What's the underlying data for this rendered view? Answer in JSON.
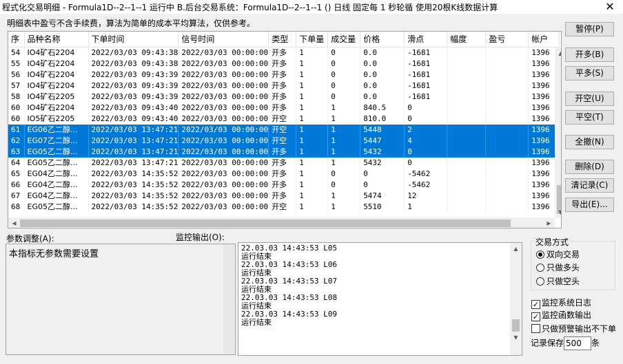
{
  "window": {
    "title": "程式化交易明细 - Formula1D--2--1--1 运行中  B.后台交易系统：Formula1D--2--1--1 () 日线 固定每 1 秒轮循 使用20根K线数据计算",
    "close": "✕"
  },
  "hint": "明细表中盈亏不含手续费，算法为简单的成本平均算法，仅供参考。",
  "table": {
    "columns": [
      "序",
      "品种名称",
      "下单时间",
      "信号时间",
      "类型",
      "下单量",
      "成交量",
      "价格",
      "滑点",
      "幅度",
      "盈亏",
      "帐户"
    ],
    "rows": [
      {
        "seq": "54",
        "name": "IO4矿石2204",
        "order_time": "2022/03/03 09:43:38",
        "signal_time": "2022/03/03 00:00:00",
        "type": "开多",
        "qty": "1",
        "filled": "0",
        "price": "0.0",
        "slip": "-1681",
        "range": "",
        "pnl": "",
        "acct": "1396",
        "selected": false
      },
      {
        "seq": "55",
        "name": "IO4矿石2204",
        "order_time": "2022/03/03 09:43:38",
        "signal_time": "2022/03/03 00:00:00",
        "type": "开多",
        "qty": "1",
        "filled": "0",
        "price": "0.0",
        "slip": "-1681",
        "range": "",
        "pnl": "",
        "acct": "1396",
        "selected": false
      },
      {
        "seq": "56",
        "name": "IO4矿石2204",
        "order_time": "2022/03/03 09:43:39",
        "signal_time": "2022/03/03 00:00:00",
        "type": "开多",
        "qty": "1",
        "filled": "0",
        "price": "0.0",
        "slip": "-1681",
        "range": "",
        "pnl": "",
        "acct": "1396",
        "selected": false
      },
      {
        "seq": "57",
        "name": "IO4矿石2204",
        "order_time": "2022/03/03 09:43:39",
        "signal_time": "2022/03/03 00:00:00",
        "type": "开多",
        "qty": "1",
        "filled": "0",
        "price": "0.0",
        "slip": "-1681",
        "range": "",
        "pnl": "",
        "acct": "1396",
        "selected": false
      },
      {
        "seq": "58",
        "name": "IO4矿石2205",
        "order_time": "2022/03/03 09:43:39",
        "signal_time": "2022/03/03 00:00:00",
        "type": "开多",
        "qty": "1",
        "filled": "0",
        "price": "0.0",
        "slip": "-1681",
        "range": "",
        "pnl": "",
        "acct": "1396",
        "selected": false
      },
      {
        "seq": "60",
        "name": "IO4矿石2204",
        "order_time": "2022/03/03 09:43:40",
        "signal_time": "2022/03/03 00:00:00",
        "type": "开多",
        "qty": "1",
        "filled": "1",
        "price": "840.5",
        "slip": "0",
        "range": "",
        "pnl": "",
        "acct": "1396",
        "selected": false
      },
      {
        "seq": "60",
        "name": "IO5矿石2205",
        "order_time": "2022/03/03 09:43:40",
        "signal_time": "2022/03/03 00:00:00",
        "type": "开空",
        "qty": "1",
        "filled": "1",
        "price": "810.0",
        "slip": "0",
        "range": "",
        "pnl": "",
        "acct": "1396",
        "selected": false
      },
      {
        "seq": "61",
        "name": "EG06乙二醇...",
        "order_time": "2022/03/03 13:47:21",
        "signal_time": "2022/03/03 00:00:00",
        "type": "开空",
        "qty": "1",
        "filled": "1",
        "price": "5448",
        "slip": "2",
        "range": "",
        "pnl": "",
        "acct": "1396",
        "selected": true
      },
      {
        "seq": "62",
        "name": "EG07乙二醇...",
        "order_time": "2022/03/03 13:47:21",
        "signal_time": "2022/03/03 00:00:00",
        "type": "开空",
        "qty": "1",
        "filled": "1",
        "price": "5447",
        "slip": "4",
        "range": "",
        "pnl": "",
        "acct": "1396",
        "selected": true
      },
      {
        "seq": "63",
        "name": "EG05乙二醇...",
        "order_time": "2022/03/03 13:47:21",
        "signal_time": "2022/03/03 00:00:00",
        "type": "开多",
        "qty": "1",
        "filled": "1",
        "price": "5432",
        "slip": "0",
        "range": "",
        "pnl": "",
        "acct": "1396",
        "selected": true
      },
      {
        "seq": "64",
        "name": "EG05乙二醇...",
        "order_time": "2022/03/03 13:47:21",
        "signal_time": "2022/03/03 00:00:00",
        "type": "开多",
        "qty": "1",
        "filled": "1",
        "price": "5432",
        "slip": "0",
        "range": "",
        "pnl": "",
        "acct": "1396",
        "selected": false
      },
      {
        "seq": "65",
        "name": "EG04乙二醇...",
        "order_time": "2022/03/03 14:35:52",
        "signal_time": "2022/03/03 00:00:00",
        "type": "开多",
        "qty": "1",
        "filled": "0",
        "price": "0",
        "slip": "-5462",
        "range": "",
        "pnl": "",
        "acct": "1396",
        "selected": false
      },
      {
        "seq": "66",
        "name": "EG04乙二醇...",
        "order_time": "2022/03/03 14:35:52",
        "signal_time": "2022/03/03 00:00:00",
        "type": "开多",
        "qty": "1",
        "filled": "0",
        "price": "0",
        "slip": "-5462",
        "range": "",
        "pnl": "",
        "acct": "1396",
        "selected": false
      },
      {
        "seq": "67",
        "name": "EG04乙二醇...",
        "order_time": "2022/03/03 14:35:52",
        "signal_time": "2022/03/03 00:00:00",
        "type": "开多",
        "qty": "1",
        "filled": "1",
        "price": "5474",
        "slip": "12",
        "range": "",
        "pnl": "",
        "acct": "1396",
        "selected": false
      },
      {
        "seq": "68",
        "name": "EG05乙二醇...",
        "order_time": "2022/03/03 14:35:52",
        "signal_time": "2022/03/03 00:00:00",
        "type": "开空",
        "qty": "1",
        "filled": "1",
        "price": "5510",
        "slip": "1",
        "range": "",
        "pnl": "",
        "acct": "1396",
        "selected": false
      }
    ]
  },
  "buttons": {
    "pause": "暂停(P)",
    "open_long": "开多(B)",
    "close_long": "平多(S)",
    "open_short": "开空(U)",
    "close_short": "平空(T)",
    "cancel_all": "全撤(N)",
    "delete": "删除(D)",
    "clear": "清记录(C)",
    "export": "导出(E)..."
  },
  "params": {
    "label": "参数调整(A):",
    "text": "本指标无参数需要设置"
  },
  "monitor": {
    "label": "监控输出(O):",
    "lines": [
      "22.03.03 14:43:53 L05",
      "运行结束",
      "22.03.03 14:43:53 L06",
      "运行结束",
      "22.03.03 14:43:53 L07",
      "运行结束",
      "22.03.03 14:43:53 L08",
      "运行结束",
      "22.03.03 14:43:53 L09",
      "运行结束"
    ]
  },
  "trade_mode": {
    "legend": "交易方式",
    "options": [
      "双向交易",
      "只做多头",
      "只做空头"
    ],
    "selected": 0
  },
  "checks": {
    "monitor_log": {
      "label": "监控系统日志",
      "checked": true
    },
    "monitor_func": {
      "label": "监控函数输出",
      "checked": true
    },
    "warn_only": {
      "label": "只做预警输出不下单",
      "checked": false
    }
  },
  "keep": {
    "prefix": "记录保存",
    "value": "500",
    "suffix": "条"
  },
  "colors": {
    "selection": "#0078d7",
    "window_bg": "#f0f0f0"
  }
}
